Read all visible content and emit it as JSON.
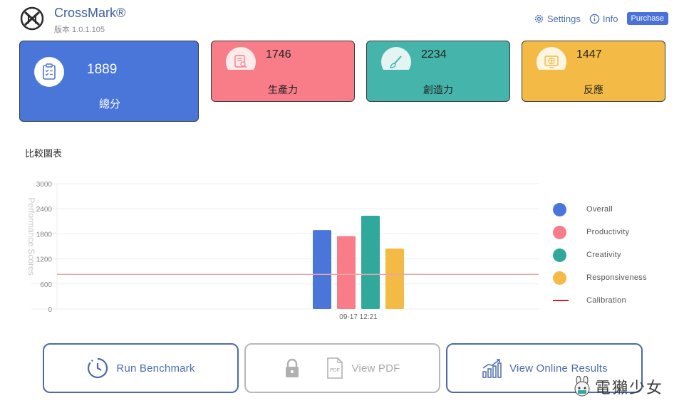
{
  "header": {
    "app_name": "CrossMark®",
    "version": "版本 1.0.1.105",
    "settings_label": "Settings",
    "info_label": "Info",
    "purchase_label": "Purchase"
  },
  "scores": {
    "overall": {
      "value": "1889",
      "label": "總分",
      "icon": "clipboard-icon",
      "color": "#4a76d9"
    },
    "productivity": {
      "value": "1746",
      "label": "生產力",
      "icon": "document-search-icon",
      "color": "#f87d88"
    },
    "creativity": {
      "value": "2234",
      "label": "創造力",
      "icon": "paintbrush-icon",
      "color": "#45b4ab"
    },
    "responsiveness": {
      "value": "1447",
      "label": "反應",
      "icon": "globe-screen-icon",
      "color": "#f3bb45"
    }
  },
  "chart_section_title": "比較圖表",
  "chart_data": {
    "type": "bar",
    "ylabel": "Performance Scores",
    "ylim": [
      0,
      3000
    ],
    "yticks": [
      "0",
      "600",
      "1200",
      "1800",
      "2400",
      "3000"
    ],
    "categories": [
      "09-17 12:21"
    ],
    "series": [
      {
        "name": "Overall",
        "values": [
          1889
        ],
        "color": "#4a76d9"
      },
      {
        "name": "Productivity",
        "values": [
          1746
        ],
        "color": "#f87d88"
      },
      {
        "name": "Creativity",
        "values": [
          2234
        ],
        "color": "#30a89c"
      },
      {
        "name": "Responsiveness",
        "values": [
          1447
        ],
        "color": "#f3bb45"
      }
    ],
    "calibration": {
      "name": "Calibration",
      "value": 1000,
      "color": "#cc2222"
    },
    "grid": true,
    "legend": "right"
  },
  "legend": [
    {
      "label": "Overall",
      "color": "#4a76d9"
    },
    {
      "label": "Productivity",
      "color": "#f87d88"
    },
    {
      "label": "Creativity",
      "color": "#30a89c"
    },
    {
      "label": "Responsiveness",
      "color": "#f3bb45"
    },
    {
      "label": "Calibration",
      "color": "#cc2222"
    }
  ],
  "actions": {
    "run_label": "Run Benchmark",
    "pdf_label": "View PDF",
    "online_label": "View Online Results"
  },
  "watermark": "電獺少女"
}
